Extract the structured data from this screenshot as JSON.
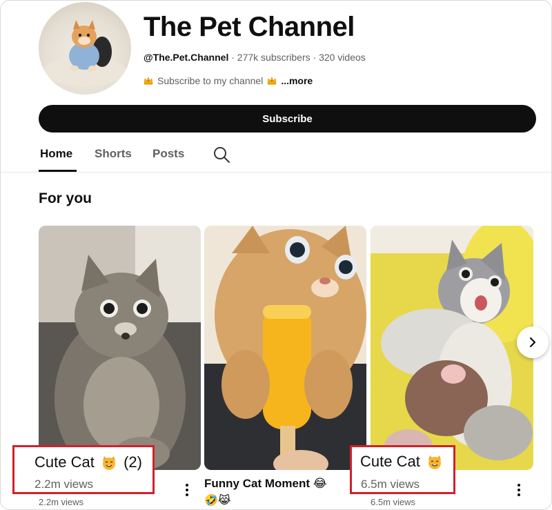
{
  "channel": {
    "name": "The Pet Channel",
    "handle": "@The.Pet.Channel",
    "sep1": "·",
    "subscribers": "277k subscribers",
    "sep2": "·",
    "videos": "320 videos",
    "description": "Subscribe to my channel",
    "more_label": "...more"
  },
  "subscribe_label": "Subscribe",
  "tabs": [
    {
      "label": "Home"
    },
    {
      "label": "Shorts"
    },
    {
      "label": "Posts"
    }
  ],
  "section_title": "For you",
  "videos": [
    {
      "title": "Cute Cat 😼 (2)",
      "views": "2.2m views"
    },
    {
      "title": "Funny Cat Moment 😂",
      "title_line2": "🤣😹",
      "views": ""
    },
    {
      "title": "Cute Cat 😼",
      "views": "6.5m views"
    }
  ],
  "card_views": [
    "2.2m views",
    "6.5m views"
  ],
  "highlights": [
    {
      "title": "Cute Cat",
      "suffix": "(2)",
      "views": "2.2m views"
    },
    {
      "title": "Cute Cat",
      "views": "6.5m views"
    }
  ],
  "colors": {
    "highlight_border": "#d21f2b",
    "subscribe_bg": "#0f0f0f"
  },
  "icons": [
    "crown-icon",
    "search-icon",
    "chevron-right-icon",
    "more-vert-icon",
    "cat-face-emoji"
  ]
}
